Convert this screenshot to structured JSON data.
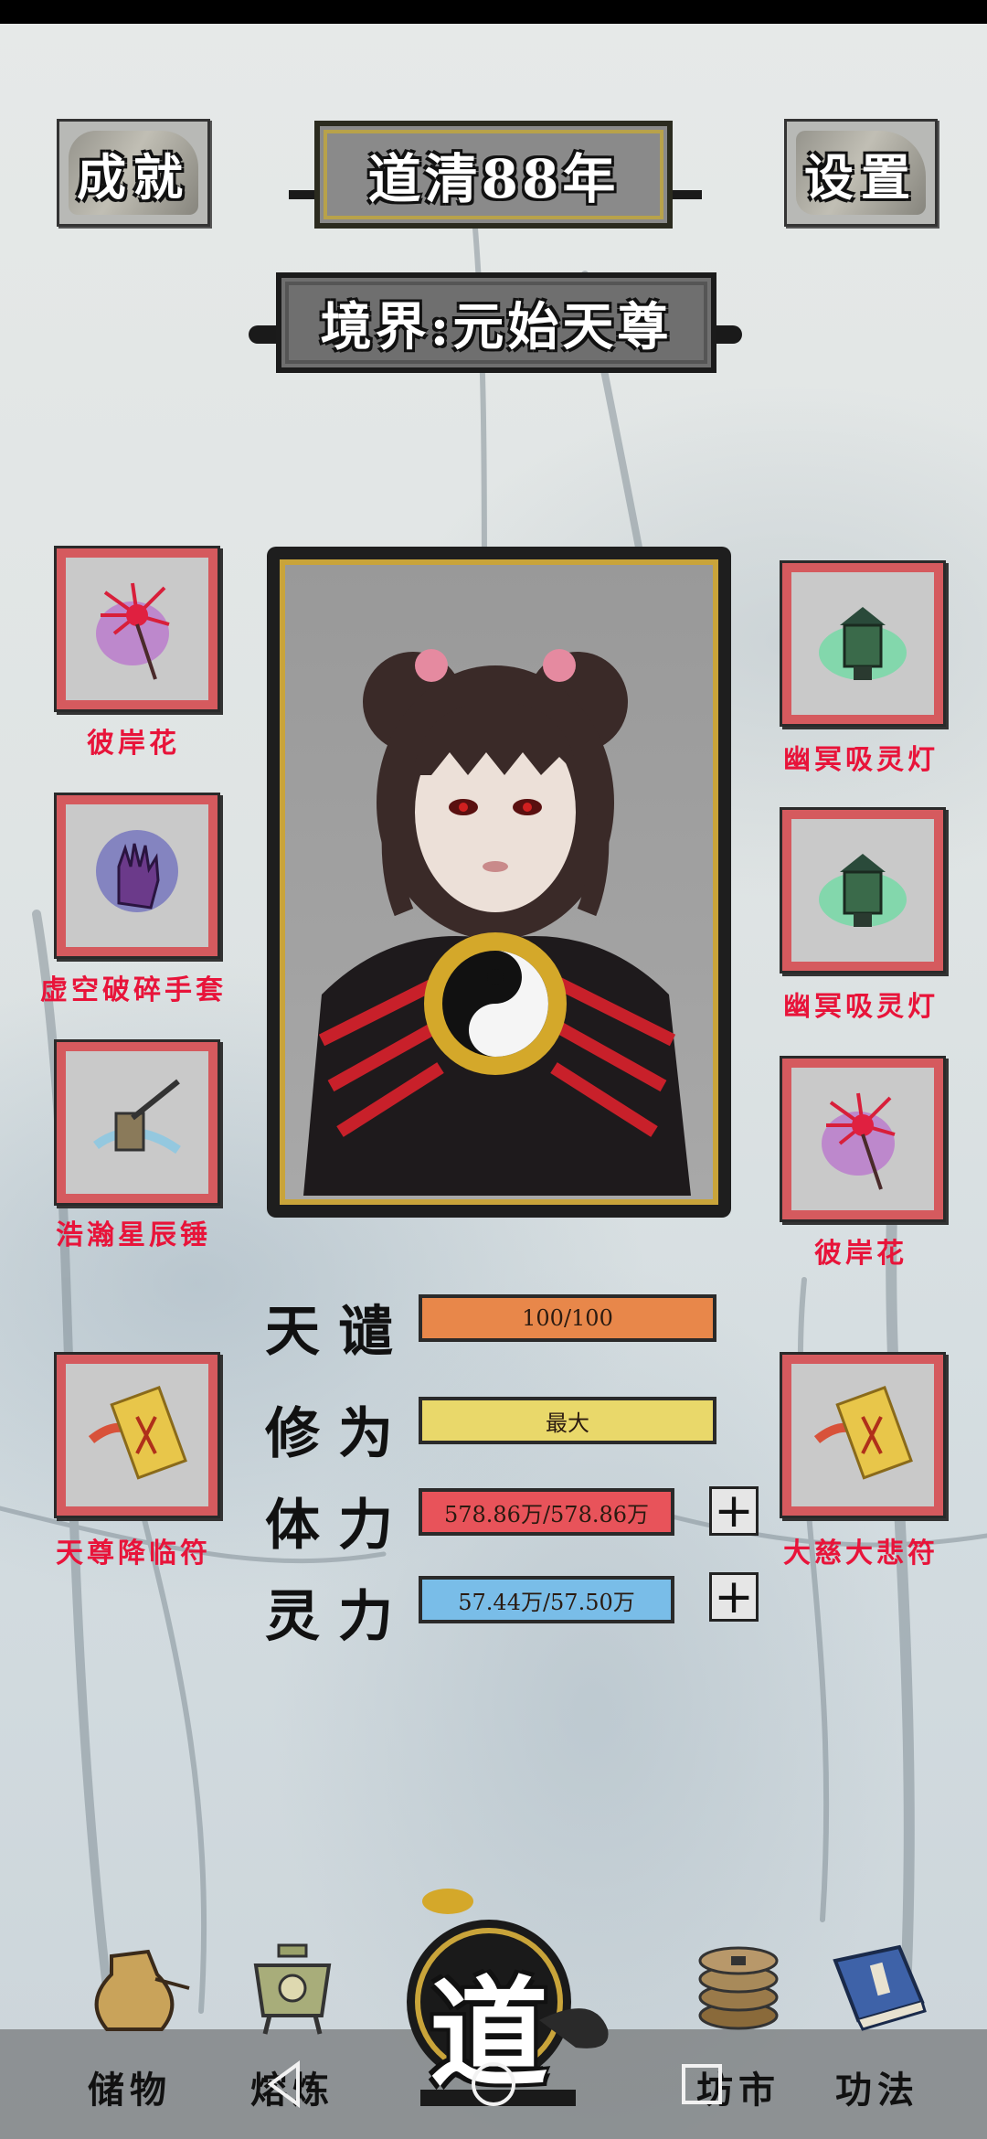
{
  "header": {
    "achievements_label": "成就",
    "year_label": "道清88年",
    "settings_label": "设置",
    "realm_label": "境界:元始天尊"
  },
  "left_slots": [
    {
      "label": "彼岸花",
      "icon": "spider-lily-icon"
    },
    {
      "label": "虚空破碎手套",
      "icon": "void-gauntlet-icon"
    },
    {
      "label": "浩瀚星辰锤",
      "icon": "star-hammer-icon"
    },
    {
      "label": "天尊降临符",
      "icon": "talisman-icon"
    }
  ],
  "right_slots": [
    {
      "label": "幽冥吸灵灯",
      "icon": "spirit-lamp-icon"
    },
    {
      "label": "幽冥吸灵灯",
      "icon": "spirit-lamp-icon"
    },
    {
      "label": "彼岸花",
      "icon": "spider-lily-icon"
    },
    {
      "label": "大慈大悲符",
      "icon": "talisman-icon"
    }
  ],
  "stats": [
    {
      "label": "天谴",
      "value": "100/100",
      "color": "#e8874a",
      "fill": 1.0
    },
    {
      "label": "修为",
      "value": "最大",
      "color": "#e9d86a",
      "fill": 1.0
    },
    {
      "label": "体力",
      "value": "578.86万/578.86万",
      "color": "#e8535a",
      "fill": 1.0
    },
    {
      "label": "灵力",
      "value": "57.44万/57.50万",
      "color": "#79bde8",
      "fill": 0.999
    }
  ],
  "bottom_nav": {
    "storage": "储物",
    "furnace": "熔炼",
    "center": "道",
    "market": "坊市",
    "skills": "功法"
  },
  "colors": {
    "slot_border": "#d55a5e",
    "slot_label": "#e8143a",
    "portrait_gold": "#c9a43a"
  }
}
